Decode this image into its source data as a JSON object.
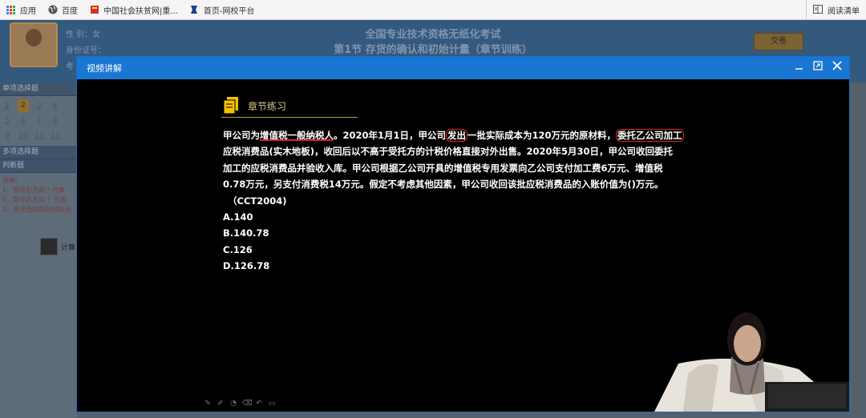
{
  "browser": {
    "bookmarks": [
      {
        "label": "应用",
        "icon": "apps-grid-icon"
      },
      {
        "label": "百度",
        "icon": "globe-icon"
      },
      {
        "label": "中国社会扶贫网|重...",
        "icon": "bookmark-icon"
      },
      {
        "label": "首页-网校平台",
        "icon": "bookmark-icon"
      }
    ],
    "reading_list": "阅读清单"
  },
  "exam": {
    "gender": "性 别：女",
    "id_label": "身份证号：",
    "exam_label": "考",
    "title": "全国专业技术资格无纸化考试",
    "subtitle": "第1节 存货的确认和初始计量（章节训练）",
    "submit_label": "交卷",
    "sidebar": {
      "single_choice": "单项选择题",
      "single_numbers": [
        "1",
        "2",
        "3",
        "4",
        "5",
        "6",
        "7",
        "8",
        "9",
        "10",
        "11",
        "12"
      ],
      "multi_choice": "多项选择题",
      "judgement": "判断题",
      "instructions": [
        "说明：",
        "1、题号右方的 * 代表",
        "2、题号右方的 ？代表",
        "3、选择选项的同时自动"
      ],
      "calculator": "计算"
    }
  },
  "modal": {
    "title": "视频讲解",
    "section_title": "章节练习",
    "question": {
      "l1": [
        "甲公司为",
        "增值税一般纳税人",
        "。2020年1月1日，甲公司",
        "发出",
        "一批实际成本为120万元的原材料，",
        "委托乙公司加工"
      ],
      "l2": "应税消费品(实木地板)，收回后以不高于受托方的计税价格直接对外出售。2020年5月30日，甲公司收回委托",
      "l3": "加工的应税消费品并验收入库。甲公司根据乙公司开具的增值税专用发票向乙公司支付加工费6万元、增值税",
      "l4": "0.78万元，另支付消费税14万元。假定不考虑其他因素，甲公司收回该批应税消费品的入账价值为()万元。",
      "l5": "（CCT2004)"
    },
    "options": [
      "A.140",
      "B.140.78",
      "C.126",
      "D.126.78"
    ]
  }
}
